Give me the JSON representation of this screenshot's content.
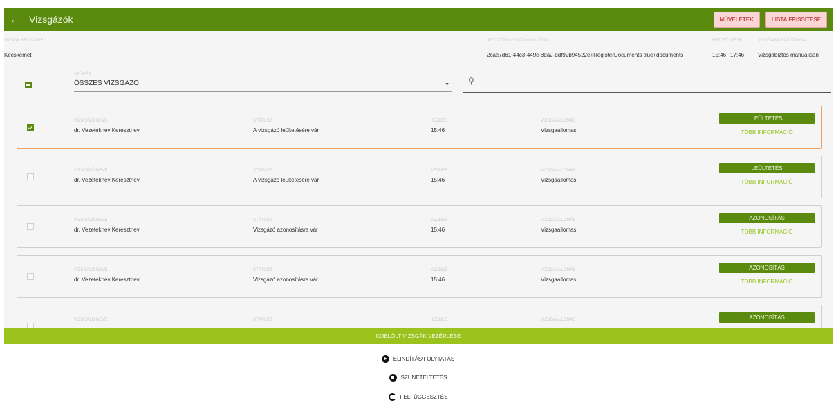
{
  "header": {
    "back_icon": "arrow-left-icon",
    "title": "Vizsgázók",
    "buttons": [
      "MŰVELETEK",
      "LISTA FRISSÍTÉSE"
    ]
  },
  "info": {
    "place_label": "VIZSGA HELYSZÍNE",
    "place_value": "Kecskemét",
    "protocol_label": "JEGYZŐKÖNYV AZONOSÍTÓJA",
    "protocol_value": "2cae7d61-44c3-449c-8da2-ddf92b94522e+RegisterDocuments true+documents",
    "start_label": "KEZDET",
    "start_value": "15:46",
    "end_label": "VÉGE",
    "end_value": "17:46",
    "type_label": "VIZSGAINDÍTÁS TÍPUSA",
    "type_value": "Vizsgabiztos manuálisan"
  },
  "filter": {
    "label": "SZŰRÉS",
    "value": "ÖSSZES VIZSGÁZÓ",
    "caret_icon": "chevron-down-icon",
    "location_icon": "map-pin-icon"
  },
  "columns": {
    "name": "VIZSGÁZÓ NEVE",
    "status": "STÁTUSZ",
    "start": "KEZDÉS",
    "station": "VIZSGAÁLLOMÁS"
  },
  "rows": [
    {
      "checked": true,
      "name": "dr. Vezeteknev Keresztnev",
      "status": "A vizsgázó leültetésére vár",
      "start": "15:46",
      "station": "Vizsgaallomas",
      "action": "LEÜLTETÉS",
      "more": "TÖBB INFORMÁCIÓ"
    },
    {
      "checked": false,
      "name": "dr. Vezeteknev Keresztnev",
      "status": "A vizsgázó leültetésére vár",
      "start": "15:46",
      "station": "Vizsgaallomas",
      "action": "LEÜLTETÉS",
      "more": "TÖBB INFORMÁCIÓ"
    },
    {
      "checked": false,
      "name": "dr. Vezeteknev Keresztnev",
      "status": "Vizsgázó azonosításra vár",
      "start": "15:46",
      "station": "Vizsgaallomas",
      "action": "AZONOSÍTÁS",
      "more": "TÖBB INFORMÁCIÓ"
    },
    {
      "checked": false,
      "name": "dr. Vezeteknev Keresztnev",
      "status": "Vizsgázó azonosításra vár",
      "start": "15:46",
      "station": "Vizsgaallomas",
      "action": "AZONOSÍTÁS",
      "more": "TÖBB INFORMÁCIÓ"
    },
    {
      "checked": false,
      "name": "",
      "status": "",
      "start": "",
      "station": "",
      "action": "AZONOSÍTÁS",
      "more": ""
    }
  ],
  "bottom": {
    "banner": "KIJELÖLT VIZSGÁK VEZÉRLÉSE",
    "start_icon": "play-circle-icon",
    "start": "ELINDÍTÁS/FOLYTATÁS",
    "pause_icon": "pause-circle-icon",
    "pause": "SZÜNETELTETÉS",
    "suspend_icon": "loading-ring-icon",
    "suspend": "FELFÜGGESZTÉS"
  },
  "colors": {
    "primary": "#5a8a0e",
    "accent": "#9bc31e",
    "selected_border": "#f0a25e"
  }
}
